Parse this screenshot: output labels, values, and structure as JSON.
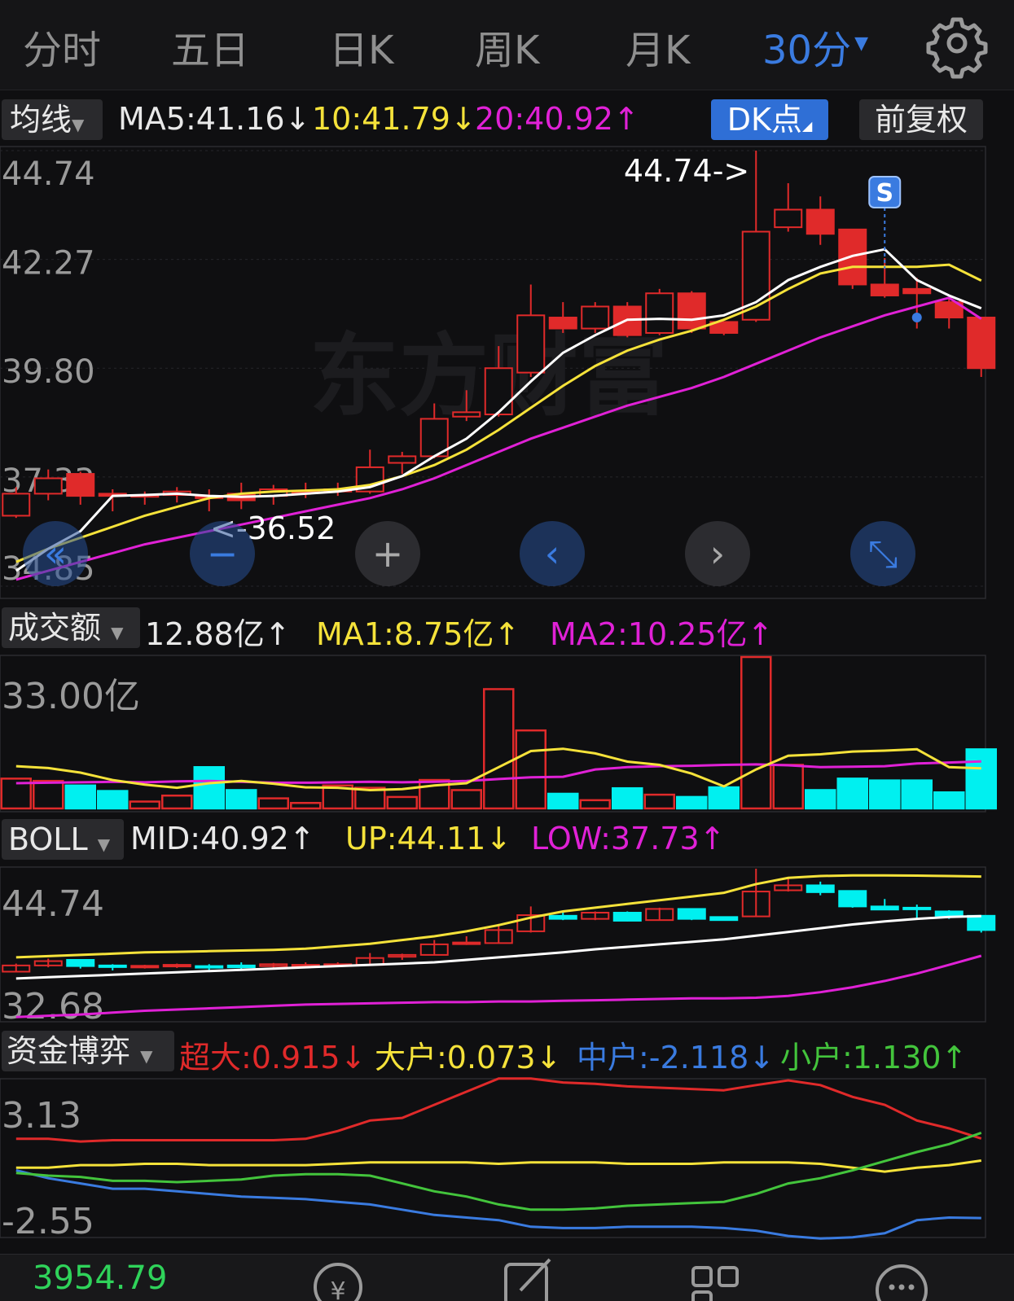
{
  "tabs": [
    "分时",
    "五日",
    "日K",
    "周K",
    "月K"
  ],
  "active_tab": "30分",
  "main_indicator": {
    "selector": "均线",
    "items": [
      {
        "text": "MA5:41.16↓",
        "color": "#ffffff"
      },
      {
        "text": "10:41.79↓",
        "color": "#f5e23a"
      },
      {
        "text": "20:40.92↑",
        "color": "#e021d6"
      }
    ],
    "dk_button": "DK点",
    "adjust_button": "前复权",
    "y_ticks": [
      "44.74",
      "42.27",
      "39.80",
      "37.33",
      "34.85"
    ],
    "high_label": "44.74->",
    "low_label": "<-36.52",
    "signal_label": "S",
    "watermark": "东方财富"
  },
  "volume_indicator": {
    "selector": "成交额",
    "items": [
      {
        "text": "12.88亿↑",
        "color": "#ffffff"
      },
      {
        "text": "MA1:8.75亿↑",
        "color": "#f5e23a"
      },
      {
        "text": "MA2:10.25亿↑",
        "color": "#e021d6"
      }
    ],
    "y_label": "33.00亿"
  },
  "boll_indicator": {
    "selector": "BOLL",
    "items": [
      {
        "text": "MID:40.92↑",
        "color": "#ffffff"
      },
      {
        "text": "UP:44.11↓",
        "color": "#f5e23a"
      },
      {
        "text": "LOW:37.73↑",
        "color": "#e021d6"
      }
    ],
    "y_ticks": [
      "44.74",
      "32.68"
    ]
  },
  "fund_indicator": {
    "selector": "资金博弈",
    "items": [
      {
        "text": "超大:0.915↓",
        "color": "#e02a2a"
      },
      {
        "text": "大户:0.073↓",
        "color": "#f5e23a"
      },
      {
        "text": "中户:-2.118↓",
        "color": "#3a7be0"
      },
      {
        "text": "小户:1.130↑",
        "color": "#43c43c"
      }
    ],
    "y_ticks": [
      "3.13",
      "-2.55"
    ]
  },
  "bottom_bar": {
    "index_value": "3954.79"
  },
  "colors": {
    "up": "#e02a2a",
    "down": "#00f0f0",
    "down_main": "#e02a2a",
    "ma5": "#ffffff",
    "ma10": "#f5e23a",
    "ma20": "#e021d6"
  },
  "chart_data": {
    "type": "candlestick",
    "period": "30分",
    "candles": [
      {
        "o": 36.45,
        "h": 37.1,
        "l": 36.4,
        "c": 36.95
      },
      {
        "o": 36.95,
        "h": 37.5,
        "l": 36.8,
        "c": 37.3
      },
      {
        "o": 37.4,
        "h": 37.45,
        "l": 36.7,
        "c": 36.9
      },
      {
        "o": 36.95,
        "h": 37.05,
        "l": 36.55,
        "c": 36.9
      },
      {
        "o": 36.88,
        "h": 37.0,
        "l": 36.7,
        "c": 36.92
      },
      {
        "o": 36.92,
        "h": 37.1,
        "l": 36.75,
        "c": 37.0
      },
      {
        "o": 36.9,
        "h": 37.05,
        "l": 36.55,
        "c": 36.85
      },
      {
        "o": 36.95,
        "h": 37.2,
        "l": 36.6,
        "c": 36.8
      },
      {
        "o": 36.9,
        "h": 37.15,
        "l": 36.7,
        "c": 37.05
      },
      {
        "o": 36.98,
        "h": 37.2,
        "l": 36.85,
        "c": 37.0
      },
      {
        "o": 37.0,
        "h": 37.2,
        "l": 36.9,
        "c": 37.05
      },
      {
        "o": 37.0,
        "h": 37.95,
        "l": 36.95,
        "c": 37.55
      },
      {
        "o": 37.65,
        "h": 37.9,
        "l": 37.4,
        "c": 37.8
      },
      {
        "o": 37.8,
        "h": 39.0,
        "l": 37.75,
        "c": 38.65
      },
      {
        "o": 38.7,
        "h": 39.3,
        "l": 38.6,
        "c": 38.8
      },
      {
        "o": 38.75,
        "h": 40.3,
        "l": 38.7,
        "c": 39.8
      },
      {
        "o": 39.7,
        "h": 41.7,
        "l": 39.6,
        "c": 41.0
      },
      {
        "o": 40.95,
        "h": 41.3,
        "l": 40.6,
        "c": 40.7
      },
      {
        "o": 40.7,
        "h": 41.3,
        "l": 40.6,
        "c": 41.2
      },
      {
        "o": 41.2,
        "h": 41.3,
        "l": 40.5,
        "c": 40.55
      },
      {
        "o": 40.6,
        "h": 41.6,
        "l": 40.55,
        "c": 41.5
      },
      {
        "o": 41.5,
        "h": 41.55,
        "l": 40.6,
        "c": 40.7
      },
      {
        "o": 40.85,
        "h": 40.85,
        "l": 40.55,
        "c": 40.6
      },
      {
        "o": 40.9,
        "h": 44.74,
        "l": 40.85,
        "c": 42.9
      },
      {
        "o": 43.0,
        "h": 44.0,
        "l": 42.9,
        "c": 43.4
      },
      {
        "o": 43.4,
        "h": 43.7,
        "l": 42.6,
        "c": 42.85
      },
      {
        "o": 42.95,
        "h": 42.95,
        "l": 41.6,
        "c": 41.7
      },
      {
        "o": 41.7,
        "h": 42.3,
        "l": 41.4,
        "c": 41.45
      },
      {
        "o": 41.6,
        "h": 41.85,
        "l": 40.7,
        "c": 41.5
      },
      {
        "o": 41.3,
        "h": 41.4,
        "l": 40.7,
        "c": 40.95
      },
      {
        "o": 40.95,
        "h": 40.95,
        "l": 39.6,
        "c": 39.8
      }
    ],
    "ma5": [
      35.2,
      35.7,
      36.1,
      36.9,
      36.92,
      36.95,
      36.9,
      36.88,
      36.9,
      36.95,
      37.0,
      37.1,
      37.35,
      37.8,
      38.2,
      38.8,
      39.5,
      40.15,
      40.55,
      40.9,
      40.92,
      40.9,
      41.0,
      41.3,
      41.8,
      42.1,
      42.35,
      42.5,
      41.8,
      41.45,
      41.16
    ],
    "ma10": [
      35.4,
      35.7,
      35.95,
      36.2,
      36.45,
      36.65,
      36.85,
      36.95,
      37.0,
      37.02,
      37.05,
      37.15,
      37.35,
      37.6,
      37.95,
      38.4,
      38.9,
      39.4,
      39.85,
      40.2,
      40.45,
      40.65,
      40.9,
      41.2,
      41.6,
      41.95,
      42.1,
      42.1,
      42.1,
      42.15,
      41.79
    ],
    "ma20": [
      35.0,
      35.2,
      35.4,
      35.6,
      35.8,
      35.95,
      36.1,
      36.25,
      36.4,
      36.55,
      36.7,
      36.85,
      37.05,
      37.3,
      37.6,
      37.9,
      38.2,
      38.45,
      38.7,
      38.95,
      39.15,
      39.35,
      39.6,
      39.9,
      40.2,
      40.5,
      40.75,
      41.0,
      41.2,
      41.4,
      40.92
    ],
    "volume": [
      6.5,
      6.0,
      5.0,
      3.8,
      1.5,
      2.8,
      9.0,
      4.0,
      2.2,
      1.2,
      5.0,
      4.5,
      2.5,
      6.2,
      4.0,
      26.0,
      17.0,
      3.2,
      1.8,
      4.4,
      3.0,
      2.5,
      4.6,
      33.0,
      9.5,
      4.0,
      6.5,
      6.1,
      6.1,
      3.5,
      12.88
    ],
    "volume_ma1": [
      9.2,
      8.8,
      7.8,
      6.2,
      5.2,
      4.5,
      5.5,
      6.0,
      5.4,
      4.6,
      4.5,
      4.0,
      4.2,
      5.0,
      5.5,
      9.0,
      12.5,
      13.0,
      12.0,
      10.2,
      9.5,
      7.6,
      4.8,
      8.5,
      11.5,
      11.8,
      12.4,
      12.6,
      12.9,
      9.0,
      8.75
    ],
    "volume_ma2": [
      5.5,
      5.6,
      5.7,
      5.8,
      5.7,
      5.9,
      6.0,
      5.8,
      5.6,
      5.6,
      5.7,
      5.8,
      5.7,
      5.8,
      6.0,
      6.4,
      6.8,
      6.9,
      8.5,
      9.0,
      9.2,
      9.3,
      9.5,
      9.6,
      9.4,
      9.0,
      9.1,
      9.2,
      9.8,
      10.0,
      10.25
    ],
    "boll_up": [
      37.6,
      37.7,
      37.8,
      37.9,
      38.0,
      38.05,
      38.1,
      38.15,
      38.2,
      38.3,
      38.5,
      38.7,
      39.0,
      39.3,
      39.7,
      40.2,
      40.8,
      41.3,
      41.6,
      41.9,
      42.2,
      42.5,
      42.8,
      43.5,
      44.0,
      44.15,
      44.2,
      44.2,
      44.18,
      44.15,
      44.11
    ],
    "boll_mid": [
      35.9,
      36.0,
      36.1,
      36.2,
      36.3,
      36.4,
      36.5,
      36.6,
      36.7,
      36.8,
      36.9,
      37.0,
      37.1,
      37.2,
      37.4,
      37.6,
      37.8,
      38.0,
      38.25,
      38.45,
      38.65,
      38.85,
      39.05,
      39.35,
      39.65,
      39.95,
      40.25,
      40.5,
      40.7,
      40.85,
      40.92
    ],
    "boll_low": [
      32.8,
      32.9,
      33.0,
      33.15,
      33.3,
      33.4,
      33.5,
      33.6,
      33.7,
      33.8,
      33.85,
      33.9,
      33.95,
      34.0,
      34.0,
      34.05,
      34.05,
      34.1,
      34.15,
      34.2,
      34.25,
      34.3,
      34.3,
      34.35,
      34.5,
      34.8,
      35.2,
      35.7,
      36.3,
      37.0,
      37.73
    ],
    "fund_super": [
      0.9,
      0.9,
      0.8,
      0.85,
      0.85,
      0.85,
      0.85,
      0.85,
      0.85,
      0.9,
      1.2,
      1.6,
      1.7,
      2.2,
      2.7,
      3.2,
      3.2,
      3.05,
      3.0,
      2.9,
      2.85,
      2.8,
      2.75,
      2.95,
      3.13,
      2.95,
      2.5,
      2.2,
      1.6,
      1.3,
      0.915
    ],
    "fund_big": [
      -0.2,
      -0.2,
      -0.1,
      -0.1,
      -0.05,
      -0.05,
      -0.1,
      -0.1,
      -0.1,
      -0.1,
      -0.05,
      0.0,
      0.0,
      0.0,
      0.0,
      -0.05,
      0.0,
      0.0,
      0.0,
      -0.05,
      -0.05,
      -0.05,
      0.0,
      0.0,
      0.0,
      -0.05,
      -0.2,
      -0.35,
      -0.2,
      -0.1,
      0.073
    ],
    "fund_mid": [
      -0.3,
      -0.6,
      -0.8,
      -1.0,
      -1.0,
      -1.1,
      -1.2,
      -1.3,
      -1.35,
      -1.4,
      -1.5,
      -1.6,
      -1.8,
      -2.0,
      -2.1,
      -2.2,
      -2.45,
      -2.5,
      -2.5,
      -2.45,
      -2.45,
      -2.45,
      -2.5,
      -2.6,
      -2.8,
      -2.9,
      -2.85,
      -2.7,
      -2.2,
      -2.1,
      -2.118
    ],
    "fund_small": [
      -0.4,
      -0.5,
      -0.55,
      -0.7,
      -0.7,
      -0.75,
      -0.7,
      -0.65,
      -0.5,
      -0.45,
      -0.45,
      -0.5,
      -0.8,
      -1.1,
      -1.3,
      -1.6,
      -1.8,
      -1.8,
      -1.75,
      -1.65,
      -1.6,
      -1.55,
      -1.5,
      -1.2,
      -0.8,
      -0.6,
      -0.3,
      0.05,
      0.4,
      0.7,
      1.13
    ]
  }
}
